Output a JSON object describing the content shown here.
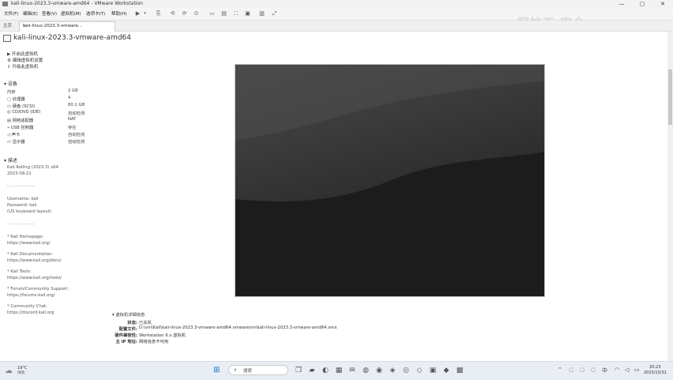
{
  "window": {
    "title": "kali-linux-2023.3-vmware-amd64 - VMware Workstation",
    "minimize": "—",
    "maximize": "▢",
    "close": "✕"
  },
  "menu": [
    "文件(F)",
    "编辑(E)",
    "查看(V)",
    "虚拟机(M)",
    "选项卡(T)",
    "帮助(H)"
  ],
  "tabs": {
    "home": "主页",
    "active": "kali-linux-2023.3-vmware..."
  },
  "vm": {
    "name": "kali-linux-2023.3-vmware-amd64",
    "actions": [
      "开启此虚拟机",
      "编辑虚拟机设置",
      "升级此虚拟机"
    ]
  },
  "devices": {
    "header": "设备",
    "rows": [
      {
        "name": "内存",
        "value": "2 GB"
      },
      {
        "name": "处理器",
        "value": "4"
      },
      {
        "name": "硬盘 (SCSI)",
        "value": "80.1 GB"
      },
      {
        "name": "CD/DVD (IDE)",
        "value": "自动检测"
      },
      {
        "name": "网络适配器",
        "value": "NAT"
      },
      {
        "name": "USB 控制器",
        "value": "存在"
      },
      {
        "name": "声卡",
        "value": "自动检测"
      },
      {
        "name": "显示器",
        "value": "自动检测"
      }
    ]
  },
  "description": {
    "header": "描述",
    "lines": [
      "Kali Rolling (2023.3) x64",
      "2023-08-21",
      "- - - - - - - - - -",
      "Username: kali",
      "Password: kali",
      "(US keyboard layout)",
      "- - - - - - - - - -",
      "* Kali Homepage:",
      "https://www.kali.org/",
      "* Kali Documentation:",
      "https://www.kali.org/docs/",
      "* Kali Tools:",
      "https://www.kali.org/tools/",
      "* Forum/Community Support:",
      "https://forums.kali.org/",
      "* Community Chat:",
      "https://discord.kali.org"
    ]
  },
  "details": {
    "header": "虚拟机详细信息",
    "rows": [
      {
        "key": "状态:",
        "value": "已关机"
      },
      {
        "key": "配置文件:",
        "value": "D:\\vm\\Kali\\kali-linux-2023.3-vmware-amd64.vmwarevm\\kali-linux-2023.3-vmware-amd64.vmx"
      },
      {
        "key": "硬件兼容性:",
        "value": "Workstation 6.x 虚拟机"
      },
      {
        "key": "主 IP 地址:",
        "value": "网络信息不可用"
      }
    ]
  },
  "watermark": "阿拉丁 安全",
  "taskbar": {
    "weather_temp": "19°C",
    "weather_desc": "晴朗",
    "search_label": "搜索",
    "time": "20:23",
    "date": "2023/10/31"
  }
}
